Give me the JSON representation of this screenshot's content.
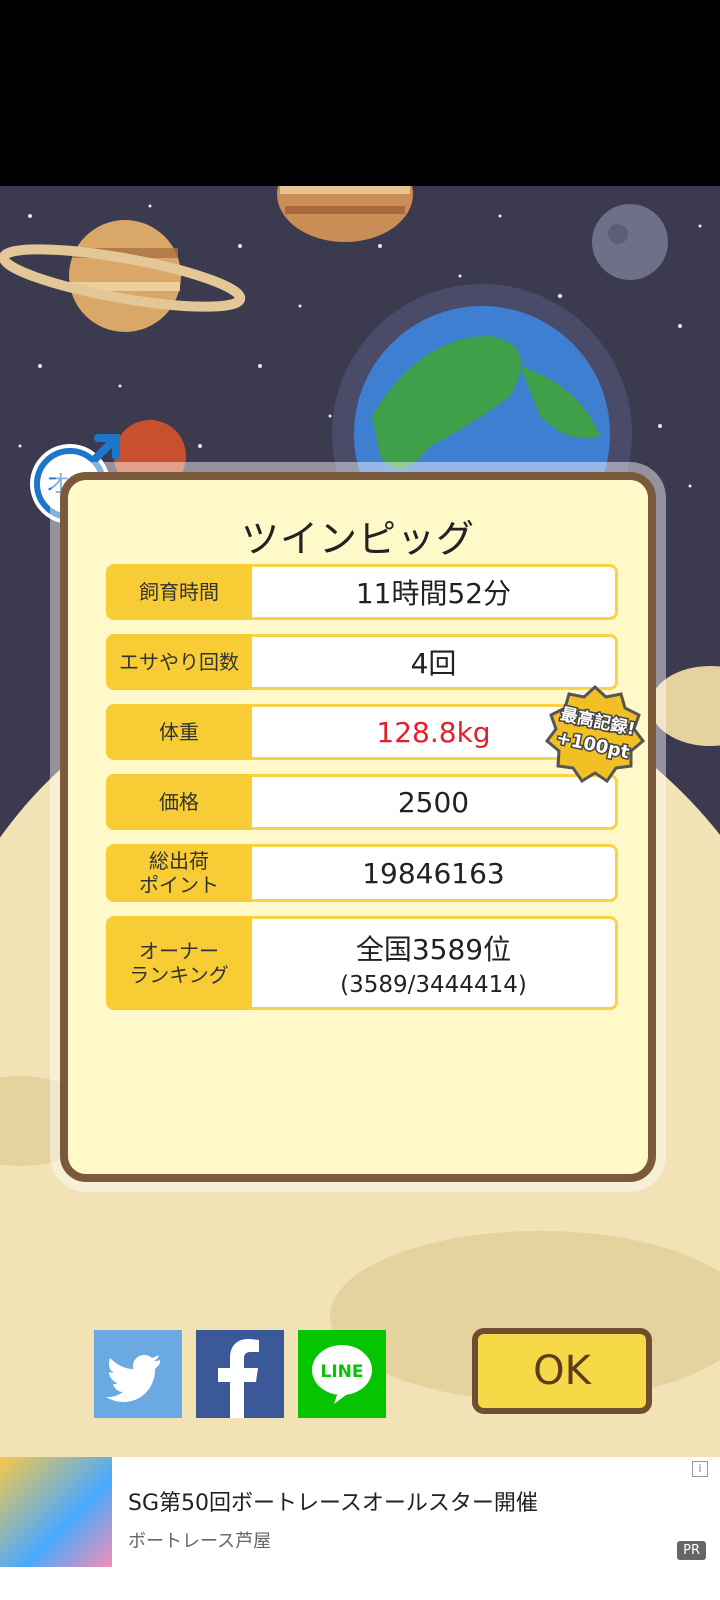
{
  "pet": {
    "name": "ツインピッグ",
    "gender_label": "オス",
    "gender_icon": "male-symbol-icon"
  },
  "stats": [
    {
      "label": "飼育時間",
      "value": "11時間52分",
      "sub": ""
    },
    {
      "label": "エサやり回数",
      "value": "4回",
      "sub": ""
    },
    {
      "label": "体重",
      "value": "128.8kg",
      "sub": "",
      "highlight": "#e0202a"
    },
    {
      "label": "価格",
      "value": "2500",
      "sub": ""
    },
    {
      "label": "総出荷\nポイント",
      "value": "19846163",
      "sub": ""
    },
    {
      "label": "オーナー\nランキング",
      "value": "全国3589位",
      "sub": "(3589/3444414)"
    }
  ],
  "badge": {
    "line1": "最高記録!",
    "line2": "+100pt"
  },
  "share": {
    "twitter_icon": "twitter-icon",
    "facebook_icon": "facebook-icon",
    "line_label": "LINE"
  },
  "ok_label": "OK",
  "ad": {
    "title": "SG第50回ボートレースオールスター開催",
    "advertiser": "ボートレース芦屋",
    "pr": "PR",
    "info": "i"
  },
  "colors": {
    "label_bg": "#f8cc34",
    "panel_bg": "#fff9c9",
    "panel_border": "#7a5a3a",
    "twitter": "#6aa9e2",
    "facebook": "#3b5998",
    "line": "#06c400"
  }
}
